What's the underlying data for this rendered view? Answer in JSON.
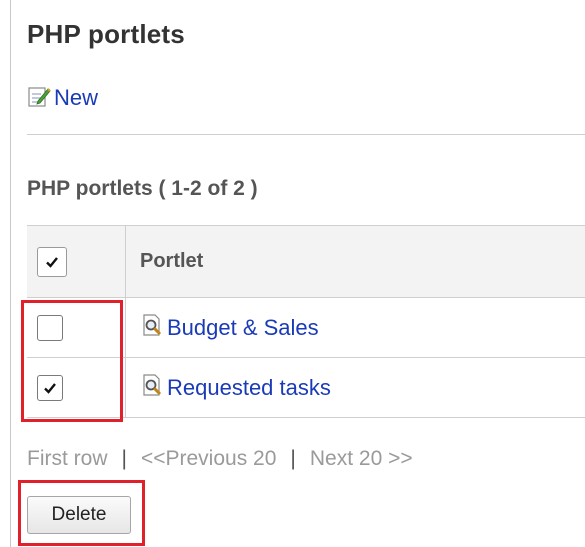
{
  "page": {
    "title": "PHP portlets"
  },
  "actions": {
    "new_label": "New",
    "delete_label": "Delete"
  },
  "list": {
    "heading": "PHP portlets ( 1-2 of 2 )",
    "column_header": "Portlet",
    "rows": [
      {
        "name": "Budget & Sales",
        "checked": false,
        "icon": "preview-icon"
      },
      {
        "name": "Requested tasks",
        "checked": true,
        "icon": "preview-icon"
      }
    ]
  },
  "pager": {
    "first": "First row",
    "separator": "|",
    "previous": "<<Previous 20",
    "next": "Next 20 >>"
  },
  "colors": {
    "link": "#1a3bb8",
    "highlight": "#e0202a",
    "border": "#cfcfcf",
    "header_bg": "#f3f3f3"
  }
}
